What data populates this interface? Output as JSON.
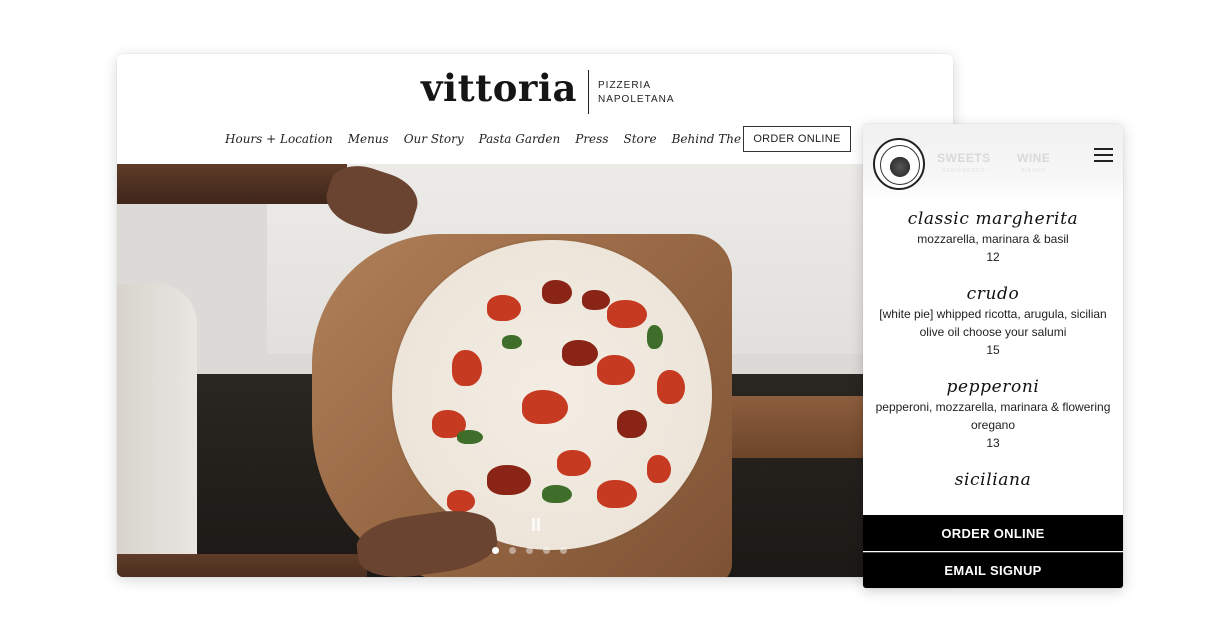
{
  "brand": {
    "name": "vittoria",
    "sub_line1": "PIZZERIA",
    "sub_line2": "NAPOLETANA"
  },
  "desktop_nav": {
    "items": [
      "Hours + Location",
      "Menus",
      "Our Story",
      "Pasta Garden",
      "Press",
      "Store",
      "Behind The Scenes"
    ],
    "order_label": "ORDER ONLINE"
  },
  "hero": {
    "slides_total": 5,
    "active_slide": 1
  },
  "mobile": {
    "header_faded": [
      {
        "label": "SWEETS",
        "sub": "SEMIFREDDO"
      },
      {
        "label": "WINE",
        "sub": "BIANCO"
      }
    ],
    "menu_items": [
      {
        "name": "classic margherita",
        "desc": "mozzarella, marinara & basil",
        "price": "12"
      },
      {
        "name": "crudo",
        "desc": "[white pie] whipped ricotta, arugula, sicilian olive oil choose your salumi",
        "price": "15"
      },
      {
        "name": "pepperoni",
        "desc": "pepperoni, mozzarella, marinara & flowering oregano",
        "price": "13"
      },
      {
        "name": "siciliana",
        "desc": "",
        "price": ""
      }
    ],
    "order_label": "ORDER ONLINE",
    "email_label": "EMAIL SIGNUP"
  },
  "colors": {
    "button_bg": "#000000",
    "button_text": "#ffffff",
    "accent_sauce": "#c63a22"
  }
}
